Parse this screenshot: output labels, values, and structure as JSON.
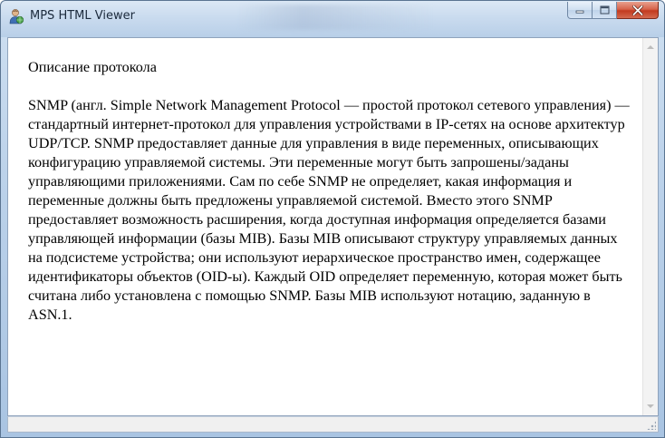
{
  "window": {
    "title": "MPS HTML Viewer",
    "app_icon": "user-with-globe-icon"
  },
  "controls": {
    "minimize": "minimize-icon",
    "maximize": "maximize-icon",
    "close": "close-icon"
  },
  "document": {
    "heading": "Описание протокола",
    "paragraph": "SNMP (англ. Simple Network Management Protocol — простой протокол сетевого управления) — стандартный интернет-протокол для управления устройствами в IP-сетях на основе архитектур UDP/TCP. SNMP предоставляет данные для управления в виде переменных, описывающих конфигурацию управляемой системы. Эти переменные могут быть запрошены/заданы управляющими приложениями. Сам по себе SNMP не определяет, какая информация и переменные должны быть предложены управляемой системой. Вместо этого SNMP предоставляет возможность расширения, когда доступная информация определяется базами управляющей информации (базы MIB). Базы MIB описывают структуру управляемых данных на подсистеме устройства; они используют иерархическое пространство имен, содержащее идентификаторы объектов (OID-ы). Каждый OID определяет переменную, которая может быть считана либо установлена с помощью SNMP. Базы MIB используют нотацию, заданную в ASN.1."
  },
  "colors": {
    "close_button": "#c9452b",
    "titlebar": "#c8daee",
    "text": "#000000"
  }
}
